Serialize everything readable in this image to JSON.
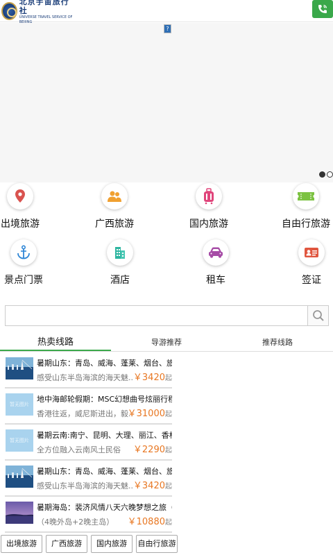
{
  "header": {
    "logo_cn": "北京宇宙旅行社",
    "logo_en": "UNIVERSE TRAVEL SERVICE OF BEIJING",
    "logo_icon": "globe-emblem",
    "phone_icon": "phone-icon",
    "accent_color": "#3aa84a"
  },
  "banner": {
    "broken_image_glyph": "?",
    "slide_count": 2,
    "active_slide": 1
  },
  "grid": [
    {
      "label": "出境旅游",
      "icon": "map-pin-icon",
      "color": "#d9534f"
    },
    {
      "label": "广西旅游",
      "icon": "people-icon",
      "color": "#f0a030"
    },
    {
      "label": "国内旅游",
      "icon": "suitcase-icon",
      "color": "#e0457b"
    },
    {
      "label": "自由行旅游",
      "icon": "ticket-icon",
      "color": "#7cc242"
    },
    {
      "label": "景点门票",
      "icon": "anchor-icon",
      "color": "#2f86d6"
    },
    {
      "label": "酒店",
      "icon": "building-icon",
      "color": "#2eb5a0"
    },
    {
      "label": "租车",
      "icon": "car-icon",
      "color": "#a64ca6"
    },
    {
      "label": "签证",
      "icon": "id-card-icon",
      "color": "#e0563f"
    }
  ],
  "search": {
    "placeholder": "",
    "value": "",
    "icon": "search-icon"
  },
  "tabs": [
    {
      "label": "热卖线路",
      "active": true
    },
    {
      "label": "导游推荐",
      "active": false
    },
    {
      "label": "推荐线路",
      "active": false
    }
  ],
  "routes": [
    {
      "title": "暑期山东：青岛、威海、蓬莱、烟台、旅顺...",
      "subtitle": "感受山东半岛海滨的海天魅...",
      "price": "￥3420",
      "unit": "起",
      "thumb": "photo"
    },
    {
      "title": "地中海邮轮假期：MSC幻想曲号炫丽行程-意...",
      "subtitle": "香港往返，威尼斯进出，毅...",
      "price": "￥31000",
      "unit": "起",
      "thumb": "placeholder",
      "thumb_text": "暂无图片"
    },
    {
      "title": "暑期云南:南宁、昆明、大理、丽江、香格里...",
      "subtitle": "全方位融入云南风土民俗",
      "price": "￥2290",
      "unit": "起",
      "thumb": "placeholder",
      "thumb_text": "暂无图片"
    },
    {
      "title": "暑期山东：青岛、威海、蓬莱、烟台、旅顺...",
      "subtitle": "感受山东半岛海滨的海天魅...",
      "price": "￥3420",
      "unit": "起",
      "thumb": "photo"
    },
    {
      "title": "暑期海岛：裴济风情八天六晚梦想之旅（外...",
      "subtitle": "（4晚外岛+2晚主岛）",
      "price": "￥10880",
      "unit": "起",
      "thumb": "photo-purple"
    }
  ],
  "bottom_buttons": [
    "出境旅游",
    "广西旅游",
    "国内旅游",
    "自由行旅游"
  ]
}
